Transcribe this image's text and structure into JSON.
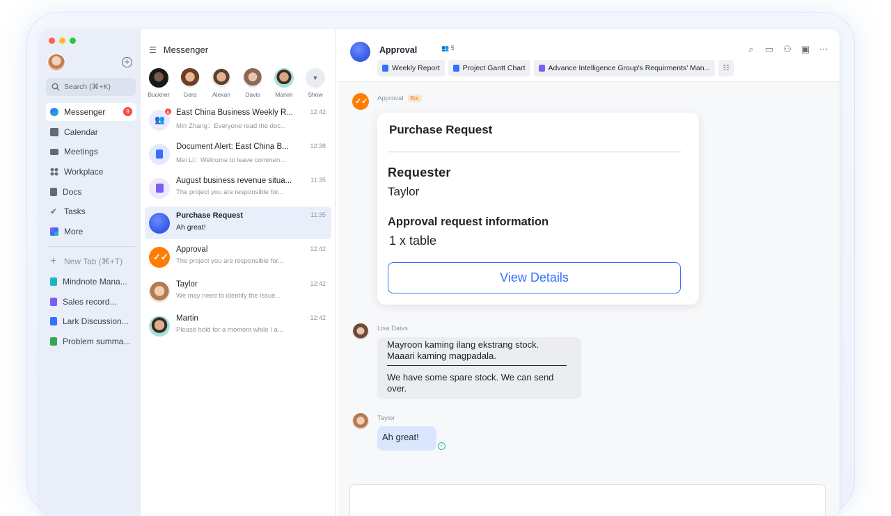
{
  "rail": {
    "search_placeholder": "Search (⌘+K)",
    "nav": [
      {
        "label": "Messenger",
        "icon": "messenger-icon",
        "badge": "9",
        "active": true
      },
      {
        "label": "Calendar",
        "icon": "calendar-icon"
      },
      {
        "label": "Meetings",
        "icon": "video-icon"
      },
      {
        "label": "Workplace",
        "icon": "grid-icon"
      },
      {
        "label": "Docs",
        "icon": "docs-icon"
      },
      {
        "label": "Tasks",
        "icon": "check-icon"
      },
      {
        "label": "More",
        "icon": "more-apps-icon"
      }
    ],
    "new_tab": "New Tab (⌘+T)",
    "tabs": [
      {
        "label": "Mindnote Mana...",
        "color": "#1fb3c5"
      },
      {
        "label": "Sales record...",
        "color": "#7f5cf5"
      },
      {
        "label": "Lark Discussion...",
        "color": "#3370ff"
      },
      {
        "label": "Problem summa...",
        "color": "#34a853"
      }
    ]
  },
  "messenger": {
    "title": "Messenger",
    "contacts": [
      "Buckner",
      "Gera",
      "Alexan",
      "Davis",
      "Marvin"
    ],
    "show_label": "Show",
    "chats": [
      {
        "title": "East China Business Weekly R...",
        "sub": "Min Zhang：Everyone read the doc...",
        "time": "12:42",
        "badge": "6"
      },
      {
        "title": "Document Alert: East China B...",
        "sub": "Mei Li：Welcome to leave commen...",
        "time": "12:38"
      },
      {
        "title": "August business revenue situa...",
        "sub": "The project you are responsible for...",
        "time": "11:35"
      },
      {
        "title": "Purchase Request",
        "sub": "Ah great!",
        "time": "11:35"
      },
      {
        "title": "Approval",
        "sub": "The project you are responsible for...",
        "time": "12:42"
      },
      {
        "title": "Taylor",
        "sub": "We may need to identify the issue...",
        "time": "12:42"
      },
      {
        "title": "Martin",
        "sub": "Please hold for a moment while I a...",
        "time": "12:42"
      }
    ]
  },
  "chat": {
    "name": "Approval",
    "member_count": "5",
    "pins": [
      "Weekly Report",
      "Project Gantt Chart",
      "Advance Intelligence Group's Requirments' Man..."
    ],
    "bot_sender": "Approval",
    "bot_tag": "Bot",
    "card": {
      "title": "Purchase Request",
      "requester_label": "Requester",
      "requester": "Taylor",
      "info_label": "Approval request information",
      "info": "1 x table",
      "button": "View Details"
    },
    "msg1_sender": "Lisa Daivs",
    "msg1_quote": "Mayroon kaming ilang ekstrang stock. Maaari kaming magpadala.",
    "msg1_text": "We have some spare stock. We can send over.",
    "msg2_sender": "Taylor",
    "msg2_text": "Ah great!"
  }
}
